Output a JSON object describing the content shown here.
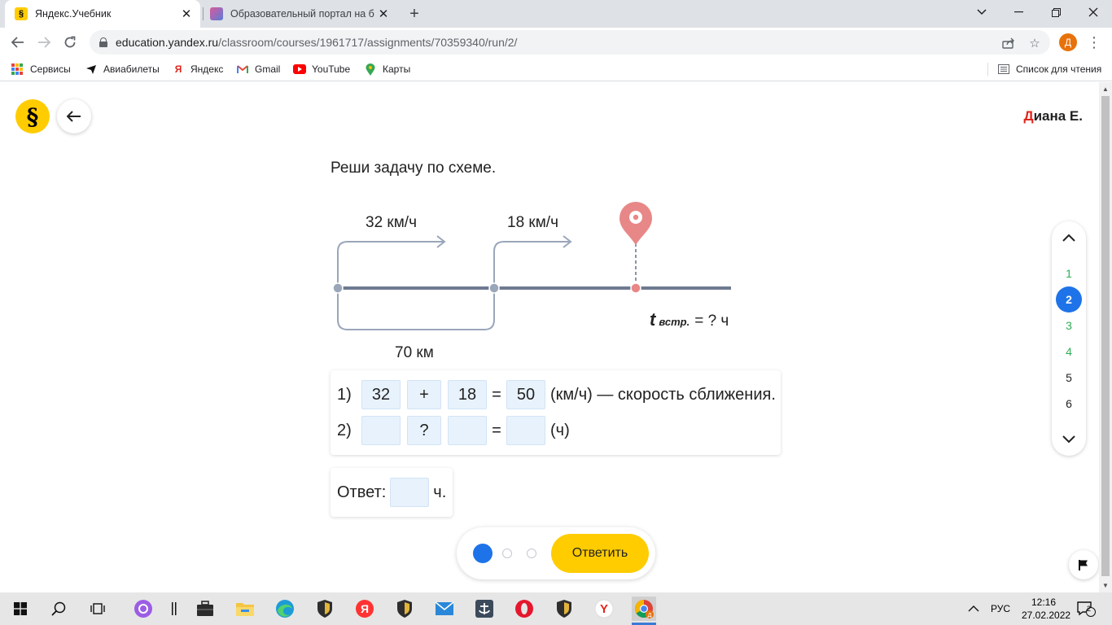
{
  "browser": {
    "tabs": [
      {
        "title": "Яндекс.Учебник",
        "favicon": "§"
      },
      {
        "title": "Образовательный портал на ба"
      }
    ],
    "url_host": "education.yandex.ru",
    "url_path": "/classroom/courses/1961717/assignments/70359340/run/2/",
    "profile_initial": "Д",
    "bookmarks": [
      {
        "label": "Сервисы",
        "icon": "apps-grid-icon"
      },
      {
        "label": "Авиабилеты",
        "icon": "plane-icon"
      },
      {
        "label": "Яндекс",
        "icon": "yandex-icon"
      },
      {
        "label": "Gmail",
        "icon": "gmail-icon"
      },
      {
        "label": "YouTube",
        "icon": "youtube-icon"
      },
      {
        "label": "Карты",
        "icon": "map-pin-icon"
      }
    ],
    "reading_list": "Список для чтения"
  },
  "page": {
    "logo": "§",
    "user_first_letter": "Д",
    "user_rest": "иана Е.",
    "task_title": "Реши задачу по схеме.",
    "diagram": {
      "speed1": "32 км/ч",
      "speed2": "18 км/ч",
      "distance": "70 км",
      "t_symbol": "t",
      "t_subscript": "встр.",
      "t_rest": "= ? ч"
    },
    "equations": [
      {
        "num": "1)",
        "a": "32",
        "op": "+",
        "b": "18",
        "eq": "=",
        "result": "50",
        "tail": "(км/ч) — скорость сближения."
      },
      {
        "num": "2)",
        "a": "",
        "op": "?",
        "b": "",
        "eq": "=",
        "result": "",
        "tail": "(ч)"
      }
    ],
    "answer": {
      "label": "Ответ:",
      "value": "",
      "unit": "ч."
    },
    "submit_label": "Ответить",
    "pager": {
      "items": [
        {
          "label": "1",
          "state": "done"
        },
        {
          "label": "2",
          "state": "current"
        },
        {
          "label": "3",
          "state": "done"
        },
        {
          "label": "4",
          "state": "done"
        },
        {
          "label": "5",
          "state": "plain"
        },
        {
          "label": "6",
          "state": "plain"
        }
      ]
    }
  },
  "taskbar": {
    "language": "РУС",
    "time": "12:16",
    "date": "27.02.2022",
    "notifications": "2"
  },
  "colors": {
    "accent_yellow": "#ffcc00",
    "accent_blue": "#1e73e8",
    "done_green": "#2eae55",
    "marker_red": "#e88787",
    "line_gray": "#6e7a90",
    "arrow_gray": "#9aa6ba"
  }
}
